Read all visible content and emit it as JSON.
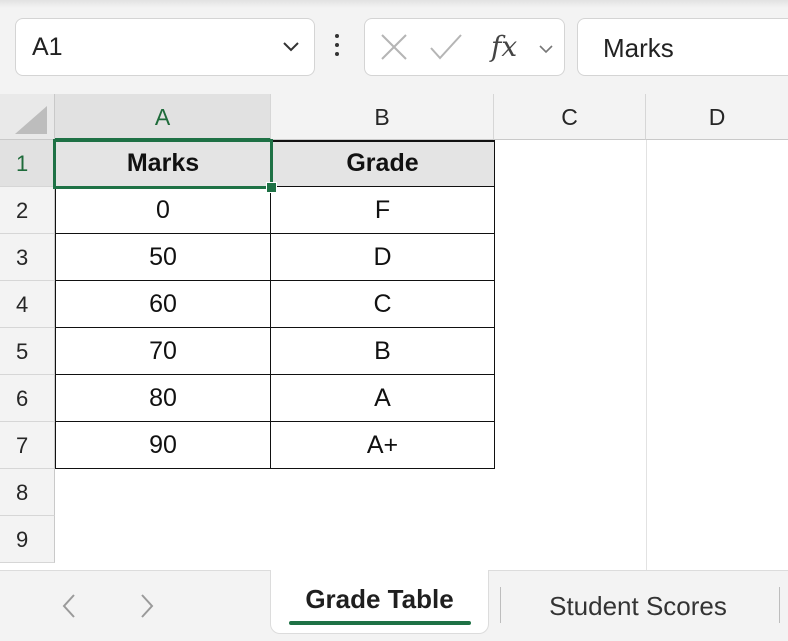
{
  "formula_bar": {
    "name_box": "A1",
    "formula_value": "Marks",
    "fx_label": "fx"
  },
  "columns": [
    "A",
    "B",
    "C",
    "D"
  ],
  "rows": [
    "1",
    "2",
    "3",
    "4",
    "5",
    "6",
    "7",
    "8",
    "9"
  ],
  "table": {
    "headers": [
      "Marks",
      "Grade"
    ],
    "rows": [
      [
        "0",
        "F"
      ],
      [
        "50",
        "D"
      ],
      [
        "60",
        "C"
      ],
      [
        "70",
        "B"
      ],
      [
        "80",
        "A"
      ],
      [
        "90",
        "A+"
      ]
    ]
  },
  "sheets": {
    "active": "Grade Table",
    "other": "Student Scores"
  },
  "colors": {
    "accent": "#1e7145",
    "header_fill": "#e4e4e4"
  }
}
